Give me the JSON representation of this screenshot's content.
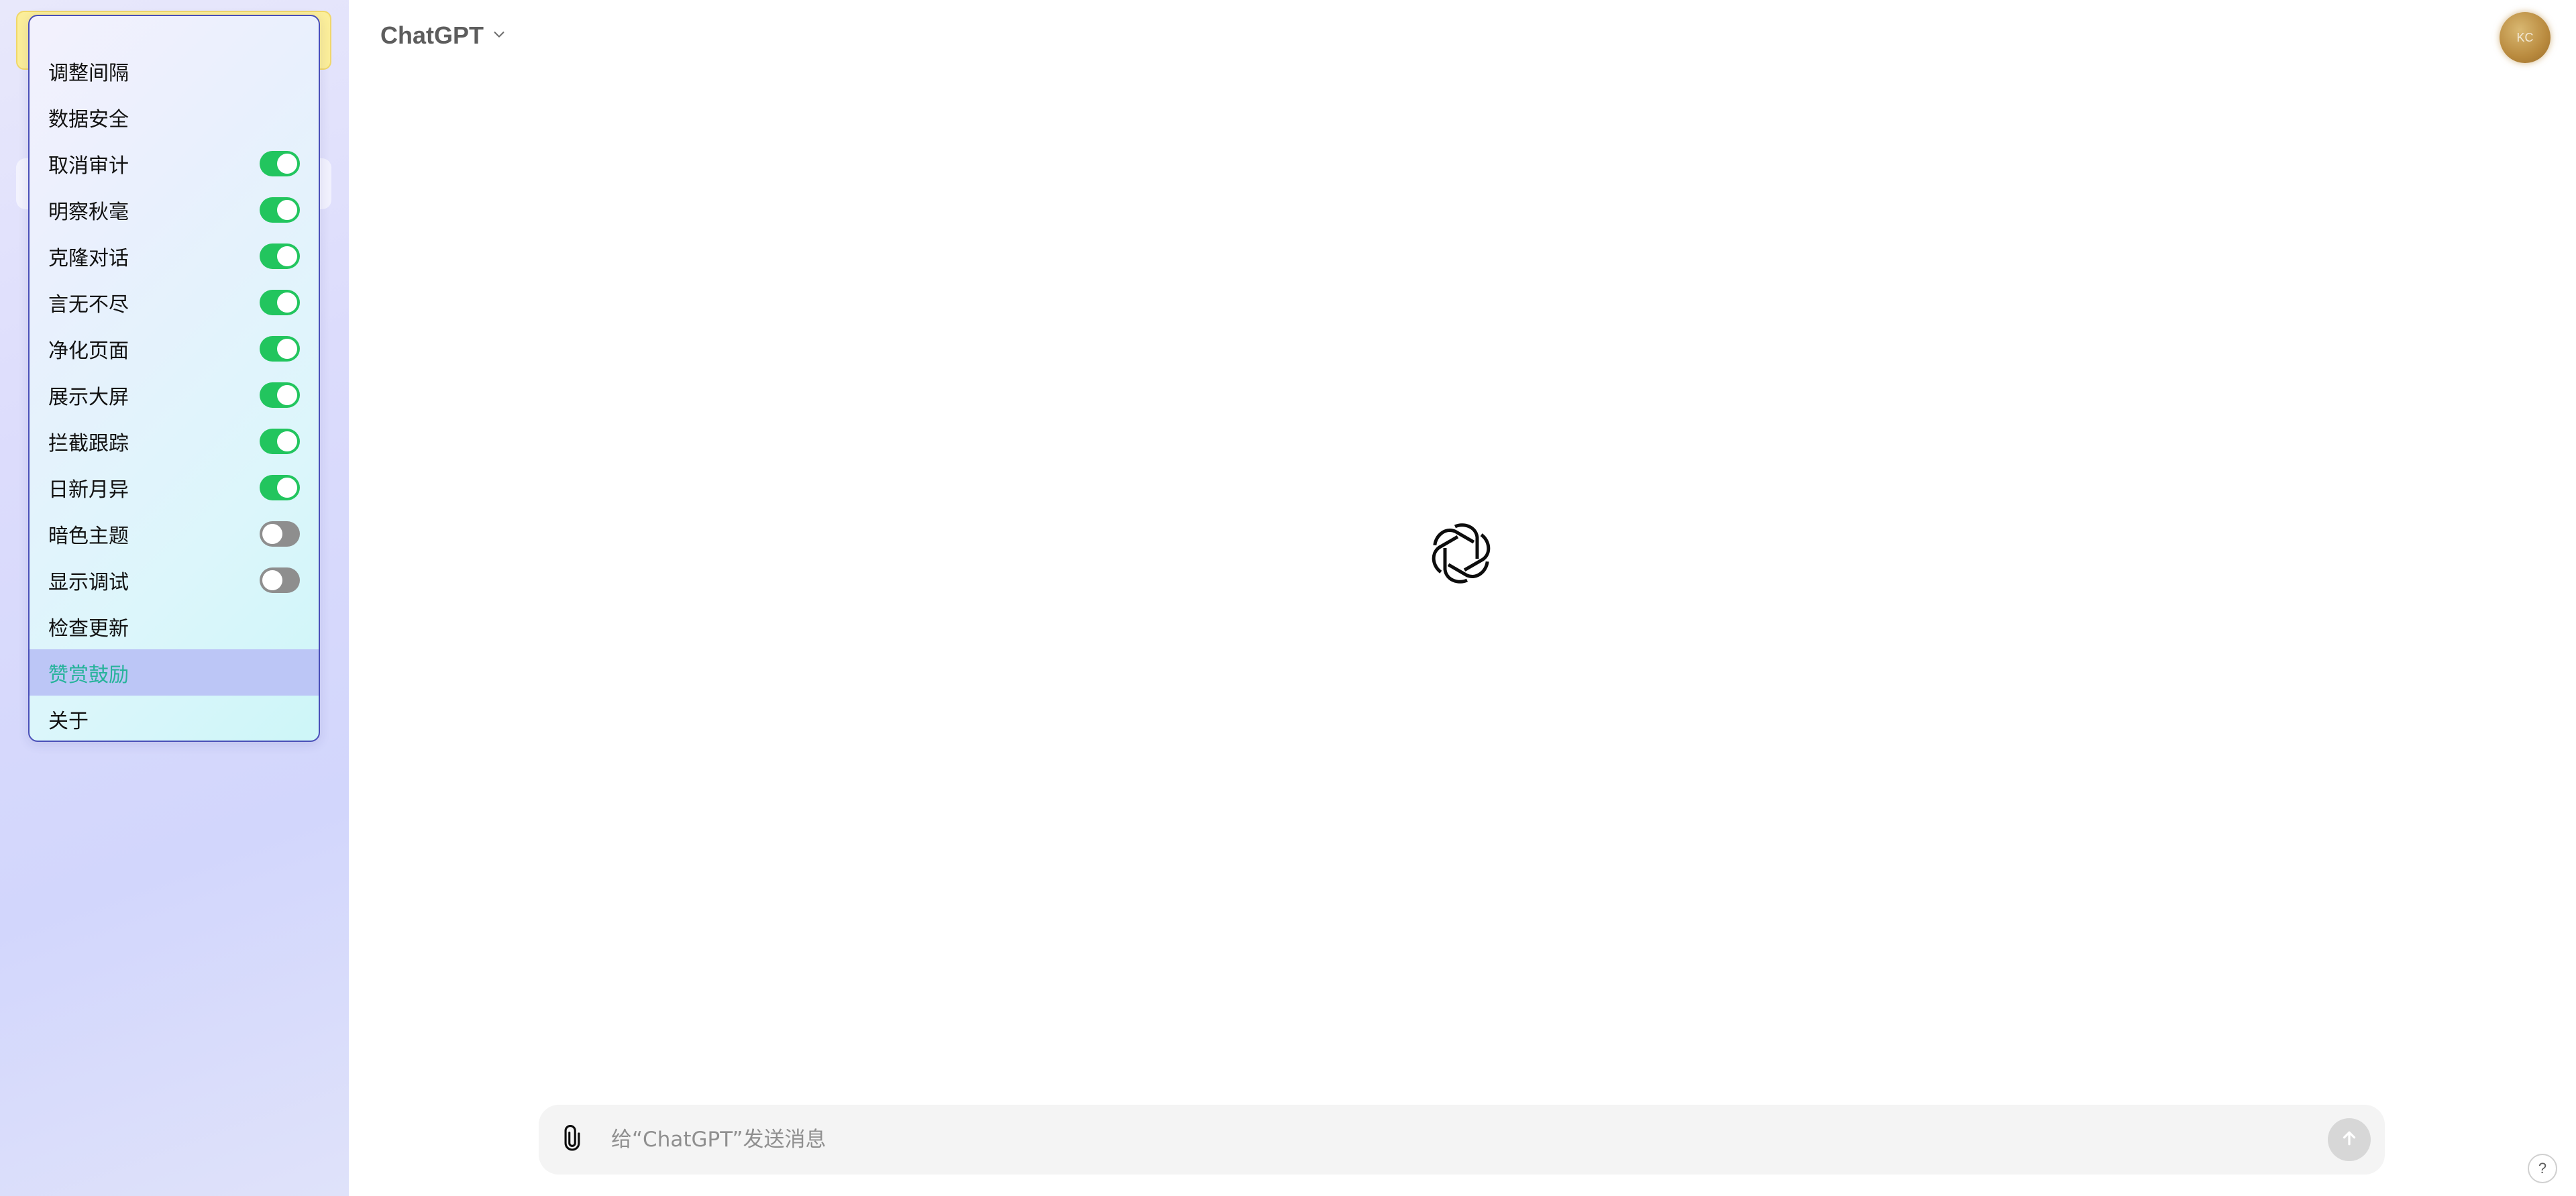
{
  "header": {
    "model_name": "ChatGPT",
    "model_chevron_icon": "chevron-down-icon",
    "avatar_initials": "KC"
  },
  "menu": {
    "items": [
      {
        "label": "调整间隔",
        "toggle": null
      },
      {
        "label": "数据安全",
        "toggle": null
      },
      {
        "label": "取消审计",
        "toggle": "on"
      },
      {
        "label": "明察秋毫",
        "toggle": "on"
      },
      {
        "label": "克隆对话",
        "toggle": "on"
      },
      {
        "label": "言无不尽",
        "toggle": "on"
      },
      {
        "label": "净化页面",
        "toggle": "on"
      },
      {
        "label": "展示大屏",
        "toggle": "on"
      },
      {
        "label": "拦截跟踪",
        "toggle": "on"
      },
      {
        "label": "日新月异",
        "toggle": "on"
      },
      {
        "label": "暗色主题",
        "toggle": "off"
      },
      {
        "label": "显示调试",
        "toggle": "off"
      },
      {
        "label": "检查更新",
        "toggle": null
      },
      {
        "label": "赞赏鼓励",
        "toggle": null,
        "highlighted": true
      },
      {
        "label": "关于",
        "toggle": null
      }
    ]
  },
  "composer": {
    "placeholder": "给“ChatGPT”发送消息",
    "attach_icon": "paperclip-icon",
    "send_icon": "arrow-up-icon"
  },
  "help": {
    "label": "?"
  },
  "colors": {
    "toggle_on": "#22c55e",
    "toggle_off": "#8e8e8e",
    "highlight_bg": "#bcc6f6",
    "highlight_text": "#27b39b",
    "menu_border": "#4a4fb8"
  }
}
